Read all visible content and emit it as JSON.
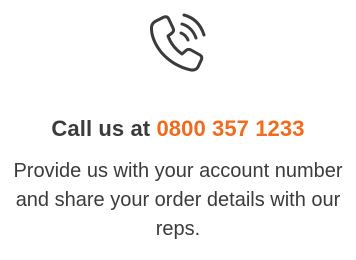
{
  "cta": {
    "icon": "phone-with-sound-waves-icon",
    "headline_prefix": "Call us at",
    "phone_number": "0800 357 1233",
    "description": "Provide us with your account number and share your order details with our reps."
  },
  "colors": {
    "accent": "#f26a1b",
    "text": "#3b3b3b",
    "background": "#ffffff"
  }
}
